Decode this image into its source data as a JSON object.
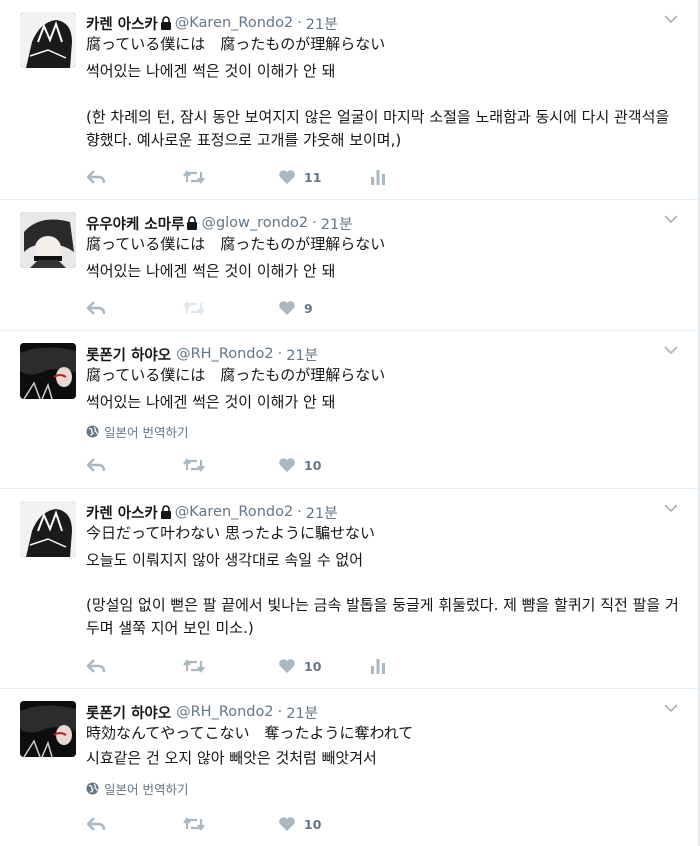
{
  "colors": {
    "action_gray": "#aab8c2",
    "meta_gray": "#657786",
    "text": "#14171a",
    "border": "#e6ecf0"
  },
  "tweets": [
    {
      "fullname": "카렌 아스카",
      "handle": "@Karen_Rondo2",
      "sep": "·",
      "time": "21분",
      "line1": "腐っている僕には　腐ったものが理解らない",
      "line2": "썩어있는 나에겐 썩은 것이 이해가 안 돼",
      "narration": "(한 차례의 턴, 잠시 동안 보여지지 않은 얼굴이 마지막 소절을 노래함과 동시에 다시 관객석을 향했다. 예사로운 표정으로 고개를 갸웃해 보이며,)",
      "likes": "11",
      "protected_icon": "lock-icon"
    },
    {
      "fullname": "유우야케 소마루",
      "handle": "@glow_rondo2",
      "sep": "·",
      "time": "21분",
      "line1": "腐っている僕には　腐ったものが理解らない",
      "line2": "썩어있는 나에겐 썩은 것이 이해가 안 돼",
      "likes": "9",
      "protected_icon": "lock-icon"
    },
    {
      "fullname": "롯폰기 하야오",
      "handle": "@RH_Rondo2",
      "sep": "·",
      "time": "21분",
      "line1": "腐っている僕には　腐ったものが理解らない",
      "line2": "썩어있는 나에겐 썩은 것이 이해가 안 돼",
      "translate": "일본어 번역하기",
      "likes": "10"
    },
    {
      "fullname": "카렌 아스카",
      "handle": "@Karen_Rondo2",
      "sep": "·",
      "time": "21분",
      "line1": "今日だって叶わない 思ったように騙せない",
      "line2": "오늘도 이뤄지지 않아 생각대로 속일 수 없어",
      "narration": "(망설임 없이 뻗은 팔 끝에서 빛나는 금속 발톱을 둥글게 휘둘렀다. 제 뺨을 할퀴기 직전 팔을 거두며 샐쭉 지어 보인 미소.)",
      "likes": "10",
      "protected_icon": "lock-icon"
    },
    {
      "fullname": "롯폰기 하야오",
      "handle": "@RH_Rondo2",
      "sep": "·",
      "time": "21분",
      "line1": "時効なんてやってこない　奪ったように奪われて",
      "line2": "시효같은 건 오지 않아 빼앗은 것처럼 빼앗겨서",
      "translate": "일본어 번역하기",
      "likes": "10"
    }
  ]
}
